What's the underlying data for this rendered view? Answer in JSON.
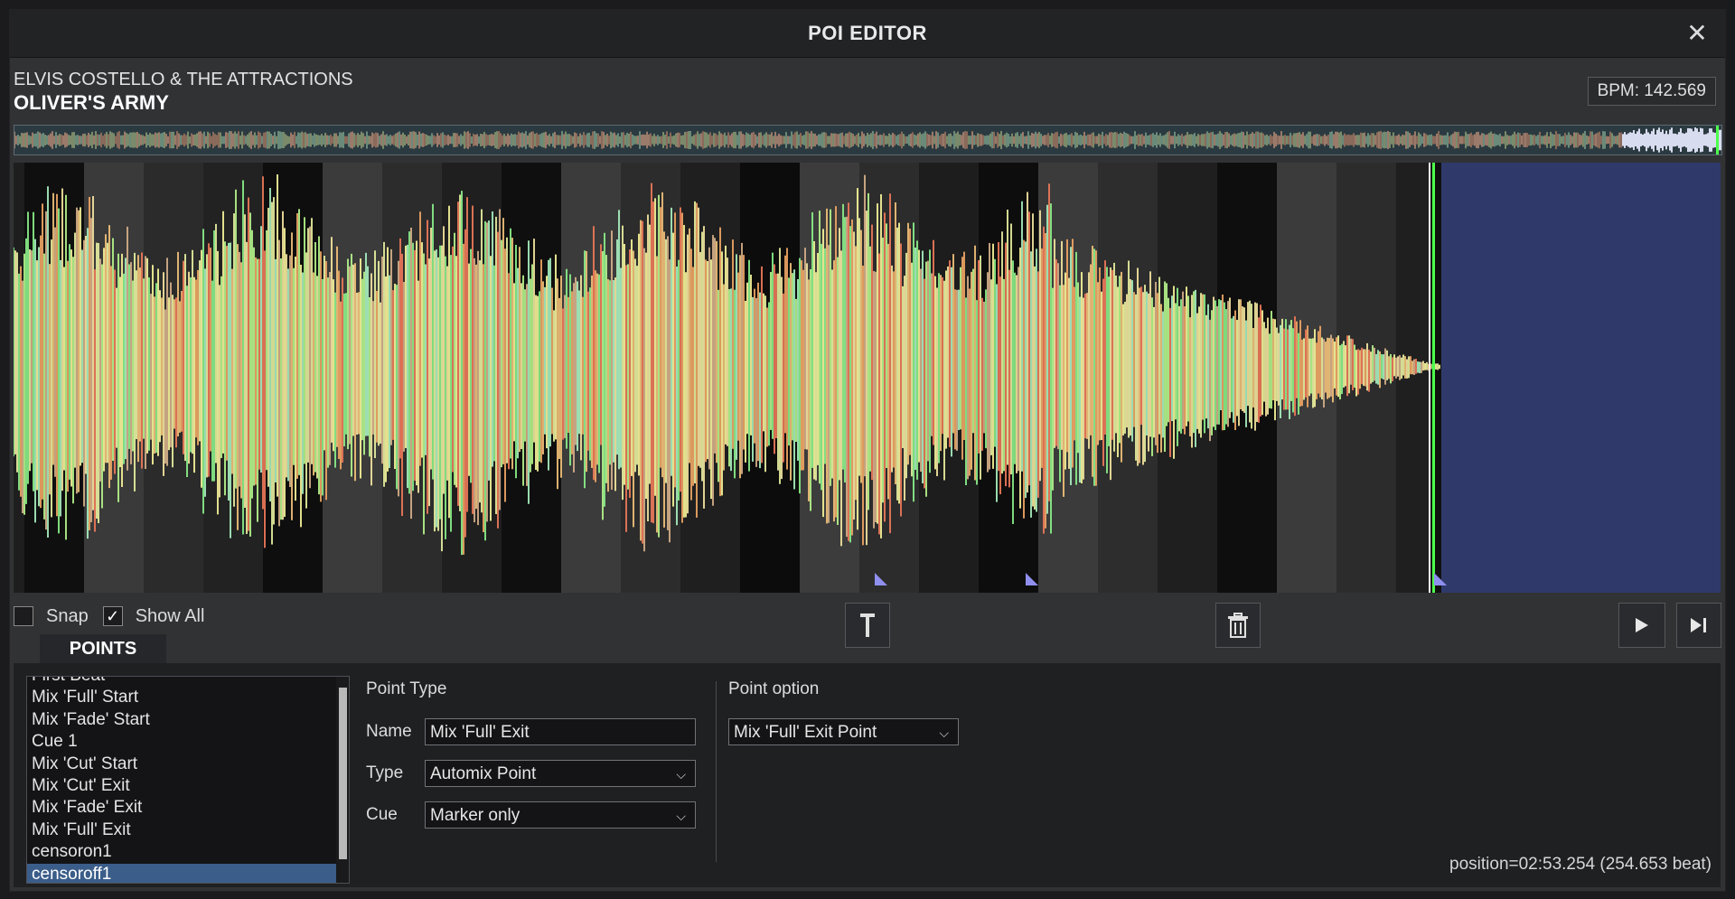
{
  "window": {
    "title": "POI EDITOR",
    "close_icon": "close-icon"
  },
  "track": {
    "artist": "ELVIS COSTELLO & THE ATTRACTIONS",
    "title": "OLIVER'S ARMY",
    "bpm": "BPM: 142.569"
  },
  "options": {
    "snap_label": "Snap",
    "snap_checked": false,
    "show_all_label": "Show All",
    "show_all_checked": true
  },
  "toolbar": {
    "add_marker_icon": "marker-pin-icon",
    "delete_icon": "trash-icon",
    "play_icon": "play-icon",
    "skip_end_icon": "skip-to-end-icon"
  },
  "tabs": {
    "points": "POINTS"
  },
  "points": {
    "items": [
      "First Beat",
      "Mix 'Full' Start",
      "Mix 'Fade' Start",
      "Cue 1",
      "Mix 'Cut' Start",
      "Mix 'Cut' Exit",
      "Mix 'Fade' Exit",
      "Mix 'Full' Exit",
      "censoron1",
      "censoroff1"
    ],
    "selected_index": 9
  },
  "editor": {
    "point_type_label": "Point Type",
    "name_label": "Name",
    "name_value": "Mix 'Full' Exit",
    "type_label": "Type",
    "type_value": "Automix Point",
    "cue_label": "Cue",
    "cue_value": "Marker only",
    "point_option_label": "Point option",
    "point_option_value": "Mix 'Full' Exit Point"
  },
  "status": {
    "position": "position=02:53.254 (254.653 beat)"
  },
  "colors": {
    "selection": "#3b5d8a",
    "waveform_end_region": "#2f3a6a",
    "marker": "#8f8ff0",
    "playhead": "#4cff4c"
  }
}
